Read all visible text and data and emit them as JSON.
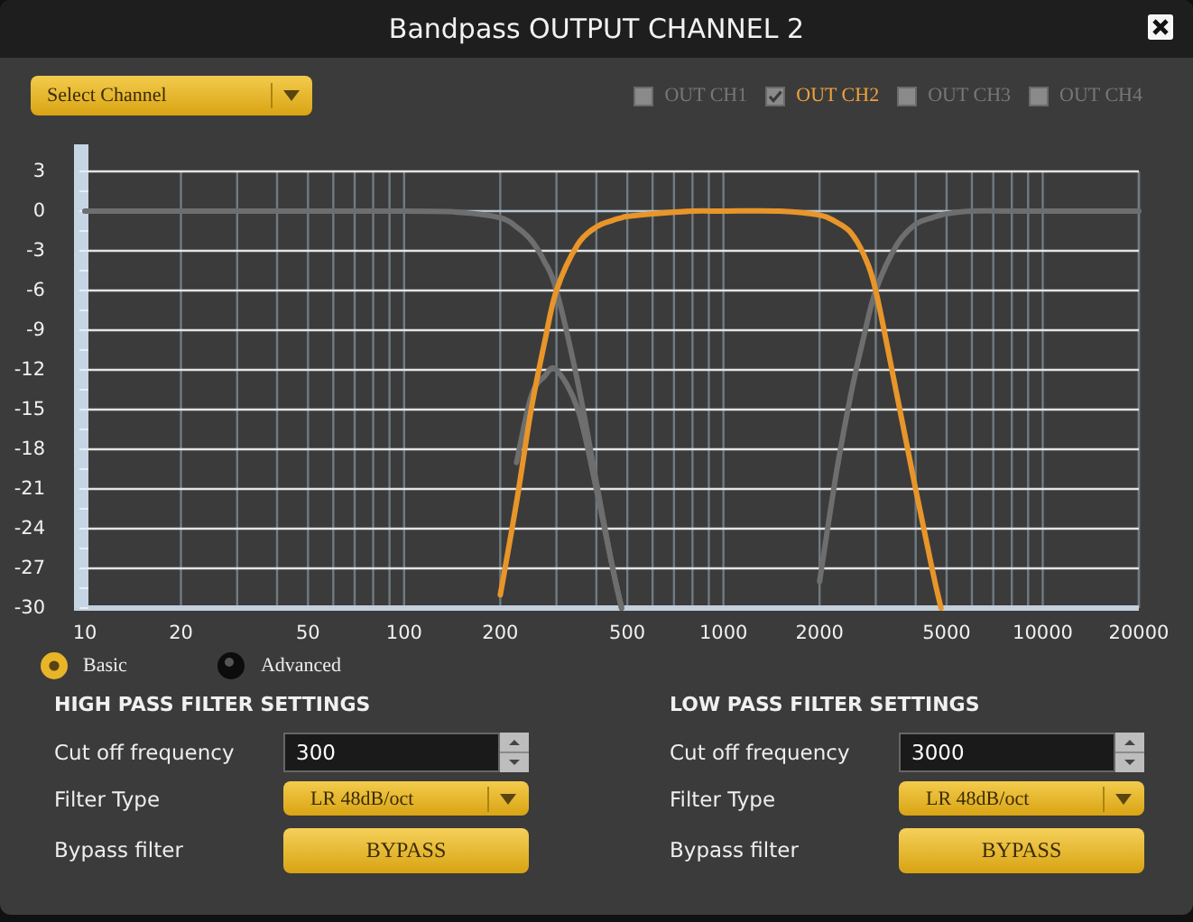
{
  "window": {
    "title": "Bandpass OUTPUT CHANNEL 2"
  },
  "channel_select": {
    "label": "Select Channel"
  },
  "channels": [
    {
      "label": "OUT CH1",
      "checked": false
    },
    {
      "label": "OUT CH2",
      "checked": true
    },
    {
      "label": "OUT CH3",
      "checked": false
    },
    {
      "label": "OUT CH4",
      "checked": false
    }
  ],
  "chart": {
    "y_labels": [
      "3",
      "0",
      "-3",
      "-6",
      "-9",
      "-12",
      "-15",
      "-18",
      "-21",
      "-24",
      "-27",
      "-30"
    ],
    "x_labels": [
      "10",
      "20",
      "50",
      "100",
      "200",
      "500",
      "1000",
      "2000",
      "5000",
      "10000",
      "20000"
    ]
  },
  "modes": [
    {
      "label": "Basic",
      "selected": true
    },
    {
      "label": "Advanced",
      "selected": false
    }
  ],
  "filters": [
    {
      "title": "HIGH PASS FILTER SETTINGS",
      "cutoff_label": "Cut off frequency",
      "cutoff": "300",
      "type_label": "Filter Type",
      "type": "LR 48dB/oct",
      "bypass_label": "Bypass filter",
      "bypass_button": "BYPASS"
    },
    {
      "title": "LOW PASS FILTER SETTINGS",
      "cutoff_label": "Cut off frequency",
      "cutoff": "3000",
      "type_label": "Filter Type",
      "type": "LR 48dB/oct",
      "bypass_label": "Bypass filter",
      "bypass_button": "BYPASS"
    }
  ]
}
